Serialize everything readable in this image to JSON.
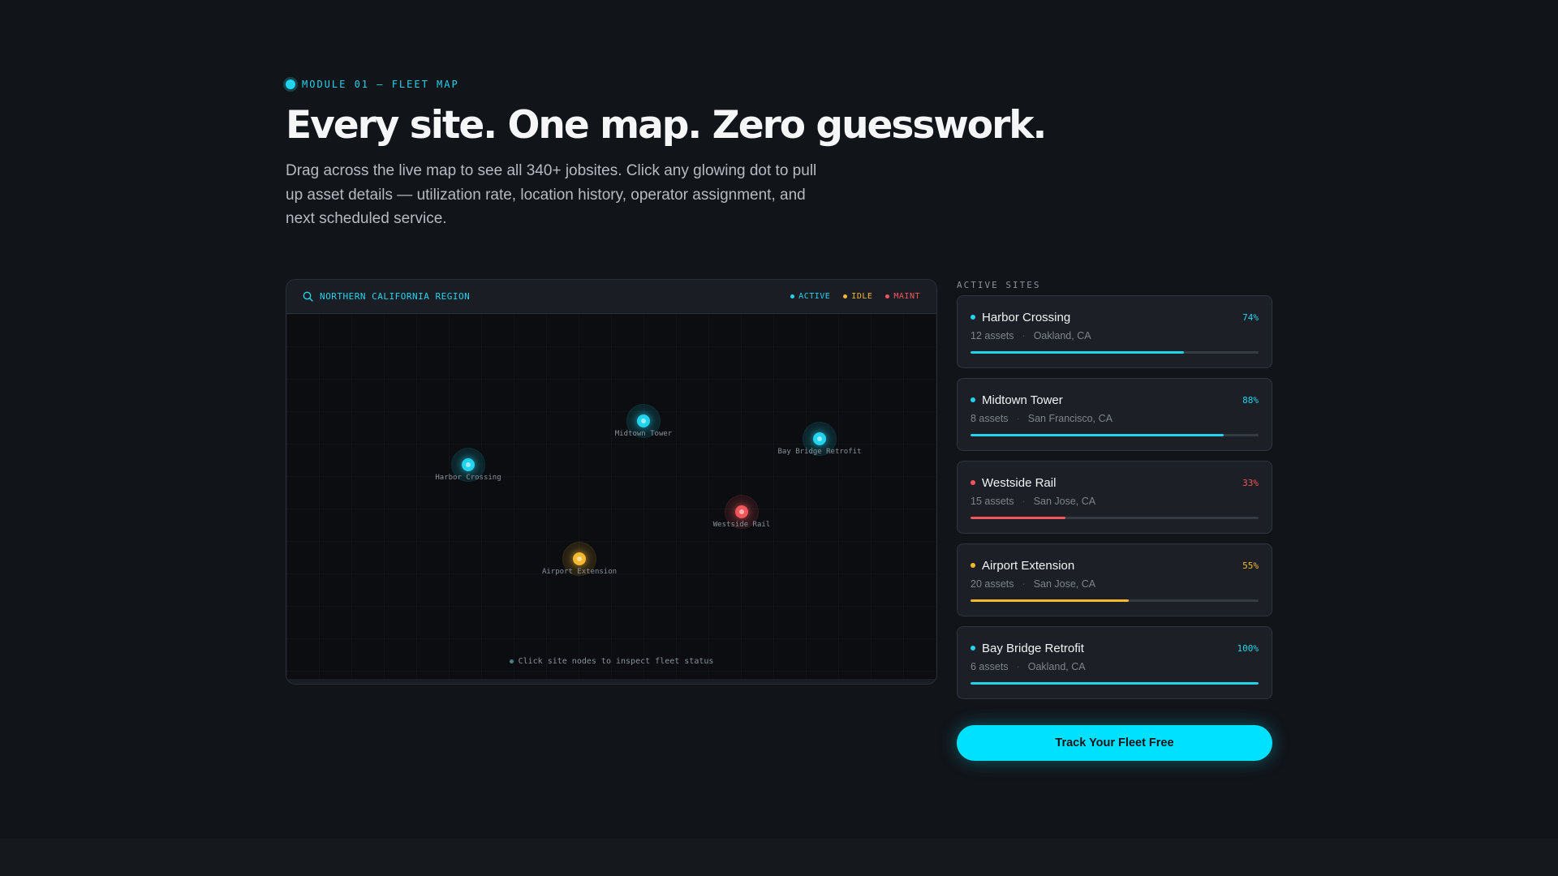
{
  "hero": {
    "eyebrow": "MODULE 01 — FLEET MAP",
    "headline": "Every site. One map. Zero guesswork.",
    "lead": "Drag across the live map to see all 340+ jobsites. Click any glowing dot to pull up asset details — utilization rate, location history, operator assignment, and next scheduled service."
  },
  "map": {
    "region": "NORTHERN CALIFORNIA REGION",
    "legend": [
      {
        "label": "ACTIVE",
        "color": "#22d3ee"
      },
      {
        "label": "IDLE",
        "color": "#f5b82e"
      },
      {
        "label": "MAINT",
        "color": "#f0565a"
      }
    ],
    "nodes": [
      {
        "name": "Harbor Crossing",
        "status": "active"
      },
      {
        "name": "Midtown Tower",
        "status": "active"
      },
      {
        "name": "Bay Bridge Retrofit",
        "status": "active"
      },
      {
        "name": "Westside Rail",
        "status": "maint"
      },
      {
        "name": "Airport Extension",
        "status": "idle"
      }
    ],
    "hint": "Click site nodes to inspect fleet status"
  },
  "sites": {
    "title": "ACTIVE SITES",
    "items": [
      {
        "name": "Harbor Crossing",
        "assets": "12 assets",
        "location": "Oakland, CA",
        "pct_label": "74%",
        "pct": 74,
        "color": "#22d3ee"
      },
      {
        "name": "Midtown Tower",
        "assets": "8 assets",
        "location": "San Francisco, CA",
        "pct_label": "88%",
        "pct": 88,
        "color": "#22d3ee"
      },
      {
        "name": "Westside Rail",
        "assets": "15 assets",
        "location": "San Jose, CA",
        "pct_label": "33%",
        "pct": 33,
        "color": "#f0565a"
      },
      {
        "name": "Airport Extension",
        "assets": "20 assets",
        "location": "San Jose, CA",
        "pct_label": "55%",
        "pct": 55,
        "color": "#f5b82e"
      },
      {
        "name": "Bay Bridge Retrofit",
        "assets": "6 assets",
        "location": "Oakland, CA",
        "pct_label": "100%",
        "pct": 100,
        "color": "#22d3ee"
      }
    ]
  },
  "cta": {
    "label": "Track Your Fleet Free"
  },
  "colors": {
    "accent": "#22d3ee",
    "idle": "#f5b82e",
    "maint": "#f0565a"
  }
}
